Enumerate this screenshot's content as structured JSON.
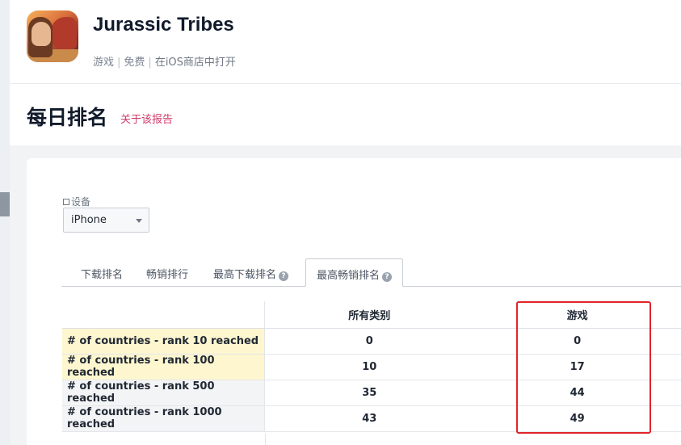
{
  "app": {
    "title": "Jurassic Tribes",
    "meta": [
      "游戏",
      "免费",
      "在iOS商店中打开"
    ]
  },
  "section": {
    "title": "每日排名",
    "report_link": "关于该报告"
  },
  "device": {
    "label": "设备",
    "selected": "iPhone"
  },
  "tabs": [
    {
      "label": "下载排名",
      "active": false,
      "help": false
    },
    {
      "label": "畅销排行",
      "active": false,
      "help": false
    },
    {
      "label": "最高下载排名",
      "active": false,
      "help": true
    },
    {
      "label": "最高畅销排名",
      "active": true,
      "help": true
    }
  ],
  "table": {
    "columns": [
      "所有类别",
      "游戏"
    ],
    "rows": [
      {
        "label": "# of countries - rank 10 reached",
        "values": [
          "0",
          "0"
        ]
      },
      {
        "label": "# of countries - rank 100 reached",
        "values": [
          "10",
          "17"
        ]
      },
      {
        "label": "# of countries - rank 500 reached",
        "values": [
          "35",
          "44"
        ]
      },
      {
        "label": "# of countries - rank 1000 reached",
        "values": [
          "43",
          "49"
        ]
      }
    ]
  },
  "colors": {
    "highlight": "#e0242a",
    "link": "#d23c6b",
    "yellow_row": "#fdf6cf"
  }
}
